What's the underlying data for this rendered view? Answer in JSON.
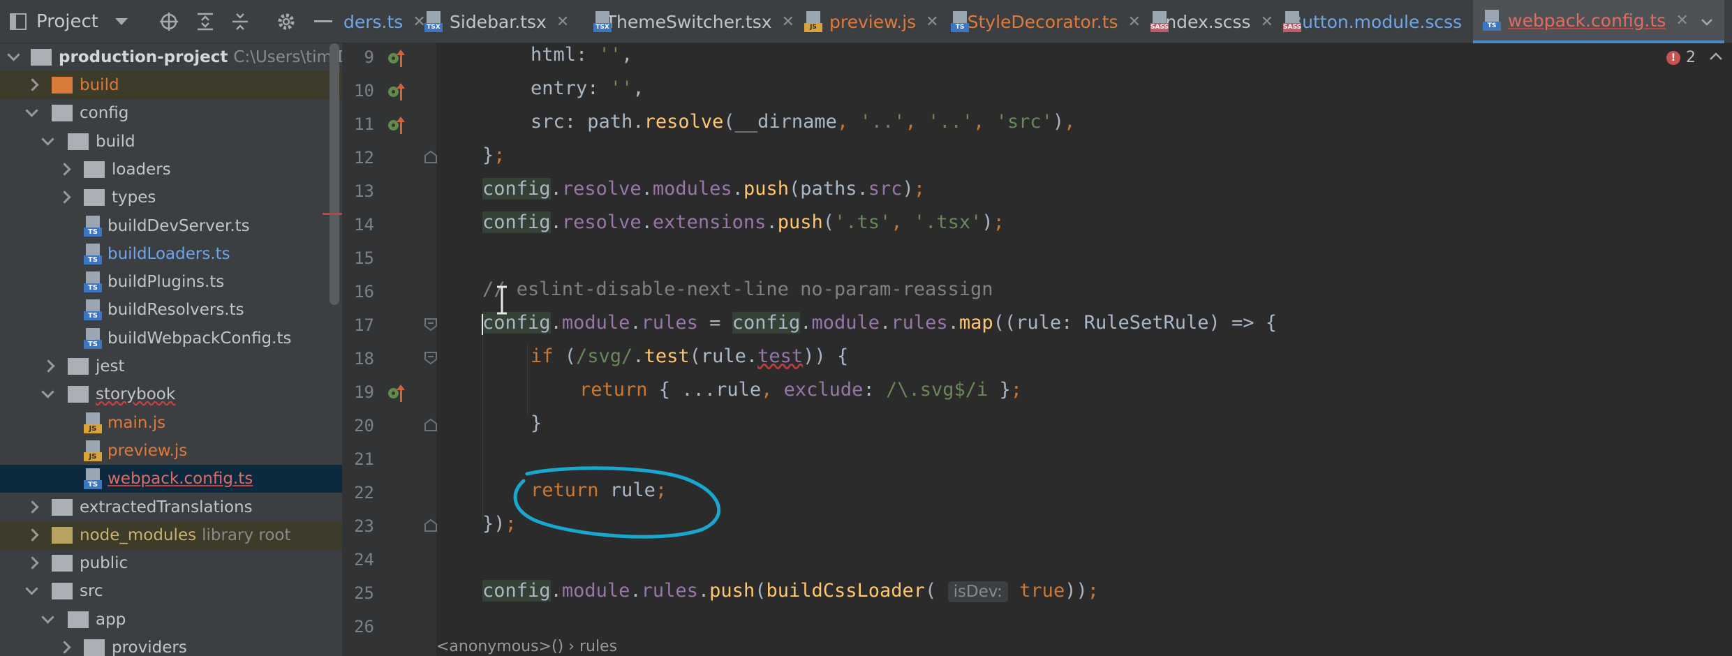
{
  "project_panel": {
    "title": "Project",
    "root": {
      "name": "production-project",
      "path": "C:\\Users\\tim\\Des"
    },
    "tree": [
      {
        "label": "build",
        "indent": 0,
        "arrow": "right",
        "icon": "folder-orange",
        "style": "orange",
        "hint": ""
      },
      {
        "label": "config",
        "indent": 0,
        "arrow": "down",
        "icon": "folder",
        "style": "",
        "hint": ""
      },
      {
        "label": "build",
        "indent": 1,
        "arrow": "down",
        "icon": "folder",
        "style": "",
        "hint": ""
      },
      {
        "label": "loaders",
        "indent": 2,
        "arrow": "right",
        "icon": "folder",
        "style": "",
        "hint": ""
      },
      {
        "label": "types",
        "indent": 2,
        "arrow": "right",
        "icon": "folder",
        "style": "",
        "hint": ""
      },
      {
        "label": "buildDevServer.ts",
        "indent": 2,
        "arrow": "none",
        "icon": "ts",
        "style": "",
        "hint": ""
      },
      {
        "label": "buildLoaders.ts",
        "indent": 2,
        "arrow": "none",
        "icon": "ts",
        "style": "blue",
        "hint": ""
      },
      {
        "label": "buildPlugins.ts",
        "indent": 2,
        "arrow": "none",
        "icon": "ts",
        "style": "",
        "hint": ""
      },
      {
        "label": "buildResolvers.ts",
        "indent": 2,
        "arrow": "none",
        "icon": "ts",
        "style": "",
        "hint": ""
      },
      {
        "label": "buildWebpackConfig.ts",
        "indent": 2,
        "arrow": "none",
        "icon": "ts",
        "style": "",
        "hint": ""
      },
      {
        "label": "jest",
        "indent": 1,
        "arrow": "right",
        "icon": "folder",
        "style": "",
        "hint": ""
      },
      {
        "label": "storybook",
        "indent": 1,
        "arrow": "down",
        "icon": "folder",
        "style": "squig",
        "hint": ""
      },
      {
        "label": "main.js",
        "indent": 2,
        "arrow": "none",
        "icon": "js",
        "style": "orange",
        "hint": ""
      },
      {
        "label": "preview.js",
        "indent": 2,
        "arrow": "none",
        "icon": "js",
        "style": "orange",
        "hint": ""
      },
      {
        "label": "webpack.config.ts",
        "indent": 2,
        "arrow": "none",
        "icon": "ts",
        "style": "red",
        "hint": "",
        "selected": true
      },
      {
        "label": "extractedTranslations",
        "indent": 0,
        "arrow": "right",
        "icon": "folder",
        "style": "",
        "hint": ""
      },
      {
        "label": "node_modules",
        "indent": 0,
        "arrow": "right",
        "icon": "folder-excluded",
        "style": "excluded",
        "hint": "library root"
      },
      {
        "label": "public",
        "indent": 0,
        "arrow": "right",
        "icon": "folder",
        "style": "",
        "hint": ""
      },
      {
        "label": "src",
        "indent": 0,
        "arrow": "down",
        "icon": "folder",
        "style": "",
        "hint": ""
      },
      {
        "label": "app",
        "indent": 1,
        "arrow": "down",
        "icon": "folder",
        "style": "",
        "hint": ""
      },
      {
        "label": "providers",
        "indent": 2,
        "arrow": "right",
        "icon": "folder",
        "style": "",
        "hint": ""
      }
    ]
  },
  "tabs": [
    {
      "label": "ders.ts",
      "icon": "",
      "style": "blue",
      "active": false
    },
    {
      "label": "Sidebar.tsx",
      "icon": "TSX",
      "style": "",
      "active": false
    },
    {
      "label": "ThemeSwitcher.tsx",
      "icon": "TSX",
      "style": "",
      "active": false
    },
    {
      "label": "preview.js",
      "icon": "JS",
      "style": "orange",
      "active": false
    },
    {
      "label": "StyleDecorator.ts",
      "icon": "TS",
      "style": "orange",
      "active": false
    },
    {
      "label": "index.scss",
      "icon": "SASS",
      "style": "",
      "active": false
    },
    {
      "label": "Button.module.scss",
      "icon": "SASS",
      "style": "blue",
      "active": false
    },
    {
      "label": "webpack.config.ts",
      "icon": "TS",
      "style": "red",
      "active": true
    }
  ],
  "editor": {
    "error_count": "2",
    "line_numbers": [
      "9",
      "10",
      "11",
      "12",
      "13",
      "14",
      "15",
      "16",
      "17",
      "18",
      "19",
      "20",
      "21",
      "22",
      "23",
      "24",
      "25",
      "26"
    ],
    "inlay_hint": "isDev:",
    "breadcrumb": "<anonymous>() › rules"
  },
  "colors": {
    "keyword": "#cc7832",
    "string": "#6a8759",
    "function": "#ffc66d",
    "property": "#9876aa",
    "comment": "#808080",
    "annotation_circle": "#1aa7cf",
    "selection": "#0d293e"
  }
}
